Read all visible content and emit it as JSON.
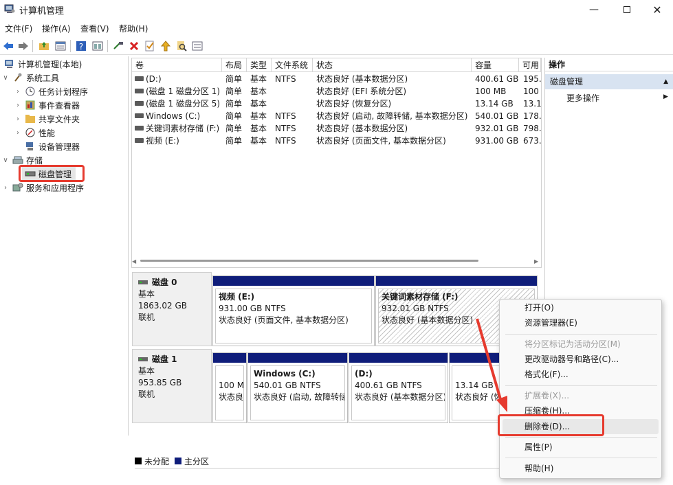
{
  "window": {
    "title": "计算机管理"
  },
  "menubar": [
    "文件(F)",
    "操作(A)",
    "查看(V)",
    "帮助(H)"
  ],
  "toolbar": [
    "back-icon",
    "forward-icon",
    "up-folder-icon",
    "properties-icon",
    "help-icon",
    "view-icon",
    "connect-icon",
    "delete-icon",
    "check-icon",
    "up-arrow-icon",
    "search-icon",
    "list-icon"
  ],
  "tree": {
    "root": "计算机管理(本地)",
    "items": [
      {
        "label": "系统工具"
      },
      {
        "label": "任务计划程序"
      },
      {
        "label": "事件查看器"
      },
      {
        "label": "共享文件夹"
      },
      {
        "label": "性能"
      },
      {
        "label": "设备管理器"
      },
      {
        "label": "存储"
      },
      {
        "label": "磁盘管理"
      },
      {
        "label": "服务和应用程序"
      }
    ]
  },
  "volumes": {
    "columns": [
      "卷",
      "布局",
      "类型",
      "文件系统",
      "状态",
      "容量",
      "可用"
    ],
    "rows": [
      [
        "(D:)",
        "简单",
        "基本",
        "NTFS",
        "状态良好 (基本数据分区)",
        "400.61 GB",
        "195."
      ],
      [
        "(磁盘 1 磁盘分区 1)",
        "简单",
        "基本",
        "",
        "状态良好 (EFI 系统分区)",
        "100 MB",
        "100"
      ],
      [
        "(磁盘 1 磁盘分区 5)",
        "简单",
        "基本",
        "",
        "状态良好 (恢复分区)",
        "13.14 GB",
        "13.1."
      ],
      [
        "Windows (C:)",
        "简单",
        "基本",
        "NTFS",
        "状态良好 (启动, 故障转储, 基本数据分区)",
        "540.01 GB",
        "178."
      ],
      [
        "关键词素材存储 (F:)",
        "简单",
        "基本",
        "NTFS",
        "状态良好 (基本数据分区)",
        "932.01 GB",
        "798."
      ],
      [
        "视频 (E:)",
        "简单",
        "基本",
        "NTFS",
        "状态良好 (页面文件, 基本数据分区)",
        "931.00 GB",
        "673."
      ]
    ]
  },
  "disks": [
    {
      "name": "磁盘 0",
      "type": "基本",
      "size": "1863.02 GB",
      "status": "联机",
      "partitions": [
        {
          "name": "视频  (E:)",
          "size": "931.00 GB NTFS",
          "status": "状态良好 (页面文件, 基本数据分区)"
        },
        {
          "name": "关键词素材存储  (F:)",
          "size": "932.01 GB NTFS",
          "status": "状态良好 (基本数据分区)"
        }
      ]
    },
    {
      "name": "磁盘 1",
      "type": "基本",
      "size": "953.85 GB",
      "status": "联机",
      "partitions": [
        {
          "name": "",
          "size": "100 M",
          "status": "状态良"
        },
        {
          "name": "Windows  (C:)",
          "size": "540.01 GB NTFS",
          "status": "状态良好 (启动, 故障转储"
        },
        {
          "name": "(D:)",
          "size": "400.61 GB NTFS",
          "status": "状态良好 (基本数据分区)"
        },
        {
          "name": "",
          "size": "13.14 GB",
          "status": "状态良好 (恢"
        }
      ]
    }
  ],
  "legend": [
    {
      "label": "未分配",
      "color": "#000000"
    },
    {
      "label": "主分区",
      "color": "#0f1d7a"
    }
  ],
  "actions": {
    "header": "操作",
    "section": "磁盘管理",
    "more": "更多操作"
  },
  "context_menu": [
    {
      "label": "打开(O)",
      "enabled": true
    },
    {
      "label": "资源管理器(E)",
      "enabled": true
    },
    {
      "label": "将分区标记为活动分区(M)",
      "enabled": false
    },
    {
      "label": "更改驱动器号和路径(C)...",
      "enabled": true
    },
    {
      "label": "格式化(F)...",
      "enabled": true
    },
    {
      "label": "扩展卷(X)...",
      "enabled": false
    },
    {
      "label": "压缩卷(H)...",
      "enabled": true
    },
    {
      "label": "删除卷(D)...",
      "enabled": true
    },
    {
      "label": "属性(P)",
      "enabled": true
    },
    {
      "label": "帮助(H)",
      "enabled": true
    }
  ],
  "colors": {
    "primary_partition": "#0f1d7a",
    "highlight_annotation": "#e63a2e",
    "action_section_bg": "#d8e3f1"
  }
}
